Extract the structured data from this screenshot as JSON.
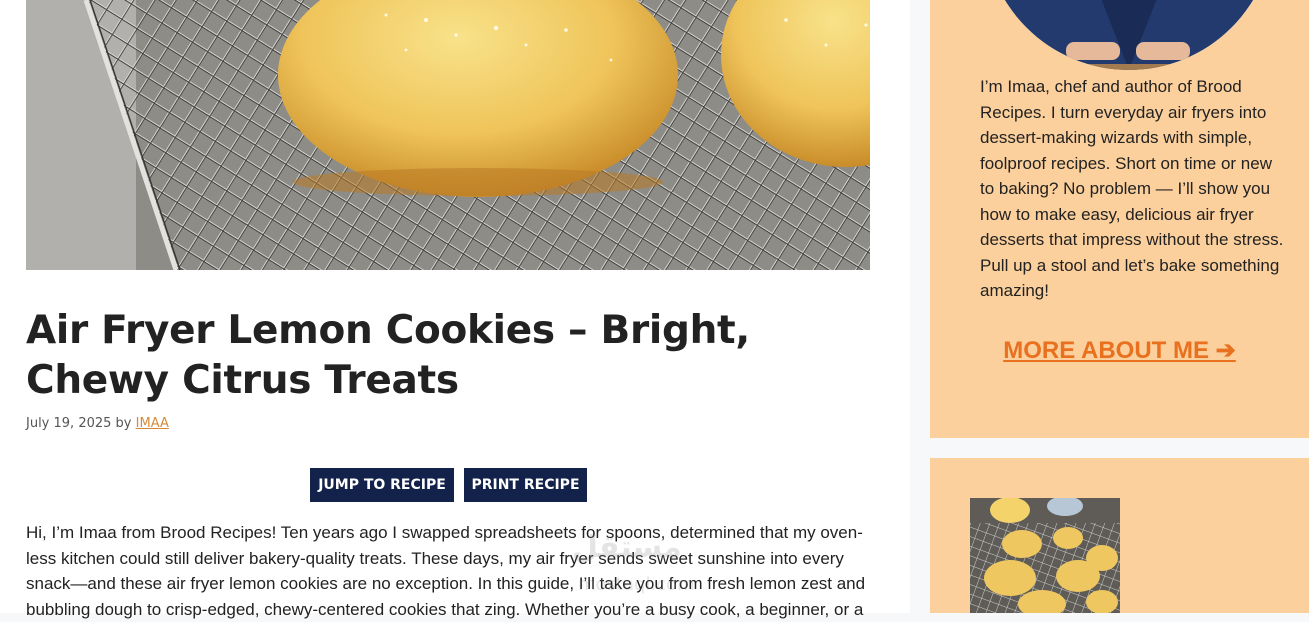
{
  "post": {
    "title": "Air Fryer Lemon Cookies – Bright, Chewy Citrus Treats",
    "date": "July 19, 2025",
    "by": "by",
    "author": "IMAA",
    "intro": "Hi, I’m Imaa from Brood Recipes! Ten years ago I swapped spreadsheets for spoons, determined that my oven-less kitchen could still deliver bakery-quality treats. These days, my air fryer sends sweet sunshine into every snack—and these air fryer lemon cookies are no exception. In this guide, I’ll take you from fresh lemon zest and bubbling dough to crisp-edged, chewy-centered cookies that zing. Whether you’re a busy cook, a beginner, or a"
  },
  "buttons": {
    "jump": "JUMP TO RECIPE",
    "print": "PRINT RECIPE"
  },
  "sidebar": {
    "bio": "I’m Imaa, chef and author of Brood Recipes. I turn everyday air fryers into dessert-making wizards with simple, foolproof recipes. Short on time or new to baking? No problem — I’ll show you how to make easy, delicious air fryer desserts that impress without the stress. Pull up a stool and let’s bake something amazing!",
    "more_link": "MORE ABOUT ME ➔"
  },
  "colors": {
    "sidebar_bg": "#fcd09c",
    "button_bg": "#13224a",
    "link_orange": "#e8701f",
    "author_link": "#d38a3a"
  },
  "watermark": {
    "text": "ﻣﺴﺘﻘﻞ",
    "sub": "mostaql.com"
  }
}
